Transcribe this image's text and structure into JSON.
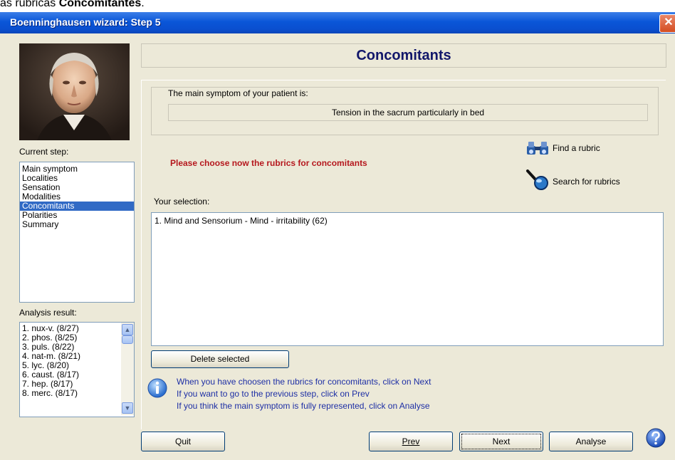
{
  "caption": {
    "prefix": "as rúbricas ",
    "bold": "Concomitantes",
    "suffix": "."
  },
  "window": {
    "title": "Boenninghausen wizard: Step 5",
    "close_glyph": "✕"
  },
  "sidebar": {
    "current_step_label": "Current step:",
    "steps": [
      "Main symptom",
      "Localities",
      "Sensation",
      "Modalities",
      "Concomitants",
      "Polarities",
      "Summary"
    ],
    "selected_step": "Concomitants",
    "analysis_label": "Analysis result:",
    "analysis_items": [
      "1. nux-v. (8/27)",
      "2. phos. (8/25)",
      "3. puls. (8/22)",
      "4. nat-m. (8/21)",
      "5. lyc. (8/20)",
      "6. caust. (8/17)",
      "7. hep. (8/17)",
      "8. merc. (8/17)"
    ]
  },
  "main": {
    "heading": "Concomitants",
    "main_symptom_label": "The main symptom of your patient is:",
    "main_symptom_value": "Tension in the sacrum particularly in bed",
    "prompt": "Please choose now the rubrics for concomitants",
    "find_rubric": "Find a rubric",
    "search_rubrics": "Search for rubrics",
    "selection_label": "Your selection:",
    "selection_items": [
      "1. Mind and Sensorium - Mind - irritability (62)"
    ],
    "delete_button": "Delete selected",
    "info_lines": [
      "When you have choosen the rubrics for concomitants, click on Next",
      "If you want to go to the previous step, click on Prev",
      "If you think the main symptom is fully represented, click on Analyse"
    ]
  },
  "buttons": {
    "quit": "Quit",
    "prev": "Prev",
    "next": "Next",
    "analyse": "Analyse"
  },
  "icons": {
    "find": "binoculars-icon",
    "search": "magnifier-icon",
    "info": "info-icon",
    "help": "help-icon"
  },
  "colors": {
    "title_bar": "#0a4fcf",
    "heading": "#12176a",
    "prompt": "#b5171d",
    "info_text": "#1e2fa5",
    "selection": "#316ac5"
  }
}
